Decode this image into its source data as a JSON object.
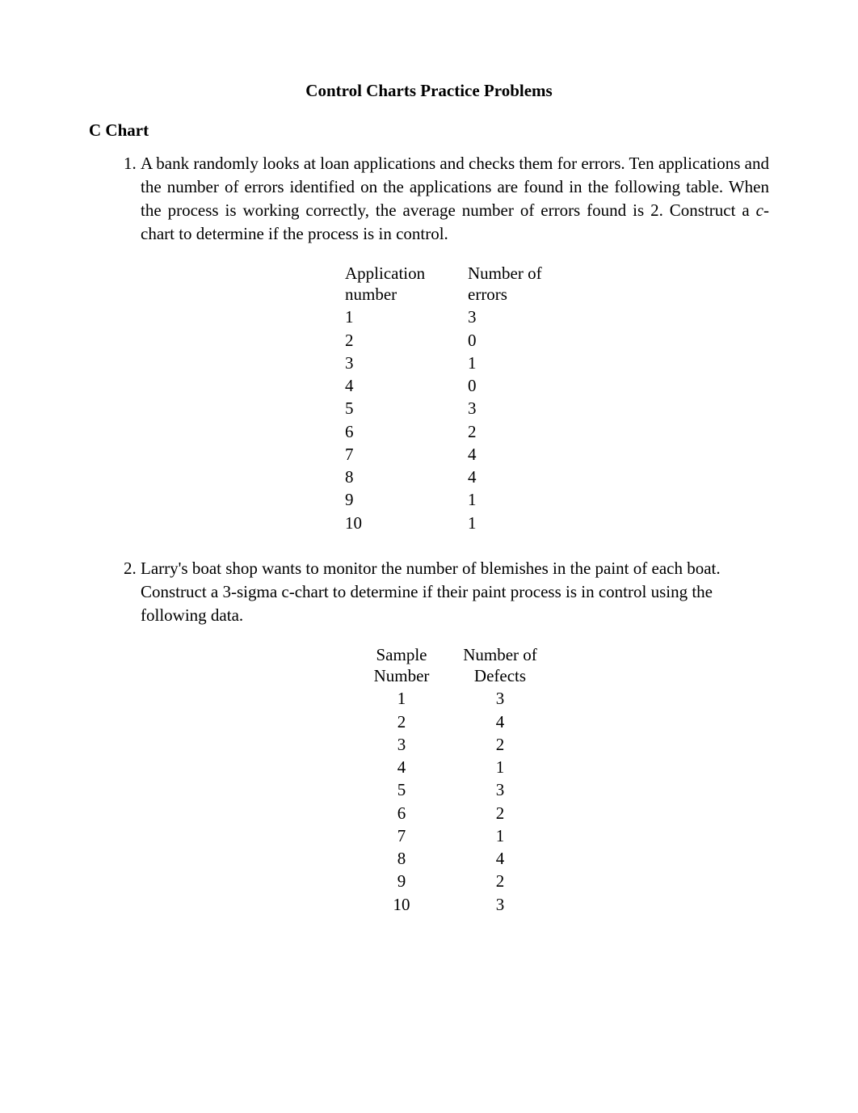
{
  "title": "Control Charts Practice Problems",
  "section_heading": "C Chart",
  "problems": [
    {
      "prompt_before_italic": "A bank randomly looks at loan applications and checks them for errors. Ten applications and the number of errors identified on the applications are found in the following table. When the process is working correctly, the average number of errors found is 2. Construct a ",
      "italic_letter": "c",
      "prompt_after_italic": "-chart to determine if the process is in control.",
      "table_headers": {
        "col1_line1": "Application",
        "col1_line2": "number",
        "col2_line1": "Number of",
        "col2_line2": "errors"
      },
      "chart_data": {
        "type": "table",
        "columns": [
          "Application number",
          "Number of errors"
        ],
        "rows": [
          {
            "label": "1",
            "value": "3"
          },
          {
            "label": "2",
            "value": "0"
          },
          {
            "label": "3",
            "value": "1"
          },
          {
            "label": "4",
            "value": "0"
          },
          {
            "label": "5",
            "value": "3"
          },
          {
            "label": "6",
            "value": "2"
          },
          {
            "label": "7",
            "value": "4"
          },
          {
            "label": "8",
            "value": "4"
          },
          {
            "label": "9",
            "value": "1"
          },
          {
            "label": "10",
            "value": "1"
          }
        ]
      }
    },
    {
      "prompt": "Larry's boat shop wants to monitor the number of blemishes in the paint of each boat. Construct a 3-sigma c-chart to determine if their paint process is in control using the following data.",
      "table_headers": {
        "col1_line1": "Sample",
        "col1_line2": "Number",
        "col2_line1": "Number of",
        "col2_line2": "Defects"
      },
      "chart_data": {
        "type": "table",
        "columns": [
          "Sample Number",
          "Number of Defects"
        ],
        "rows": [
          {
            "label": "1",
            "value": "3"
          },
          {
            "label": "2",
            "value": "4"
          },
          {
            "label": "3",
            "value": "2"
          },
          {
            "label": "4",
            "value": "1"
          },
          {
            "label": "5",
            "value": "3"
          },
          {
            "label": "6",
            "value": "2"
          },
          {
            "label": "7",
            "value": "1"
          },
          {
            "label": "8",
            "value": "4"
          },
          {
            "label": "9",
            "value": "2"
          },
          {
            "label": "10",
            "value": "3"
          }
        ]
      }
    }
  ]
}
